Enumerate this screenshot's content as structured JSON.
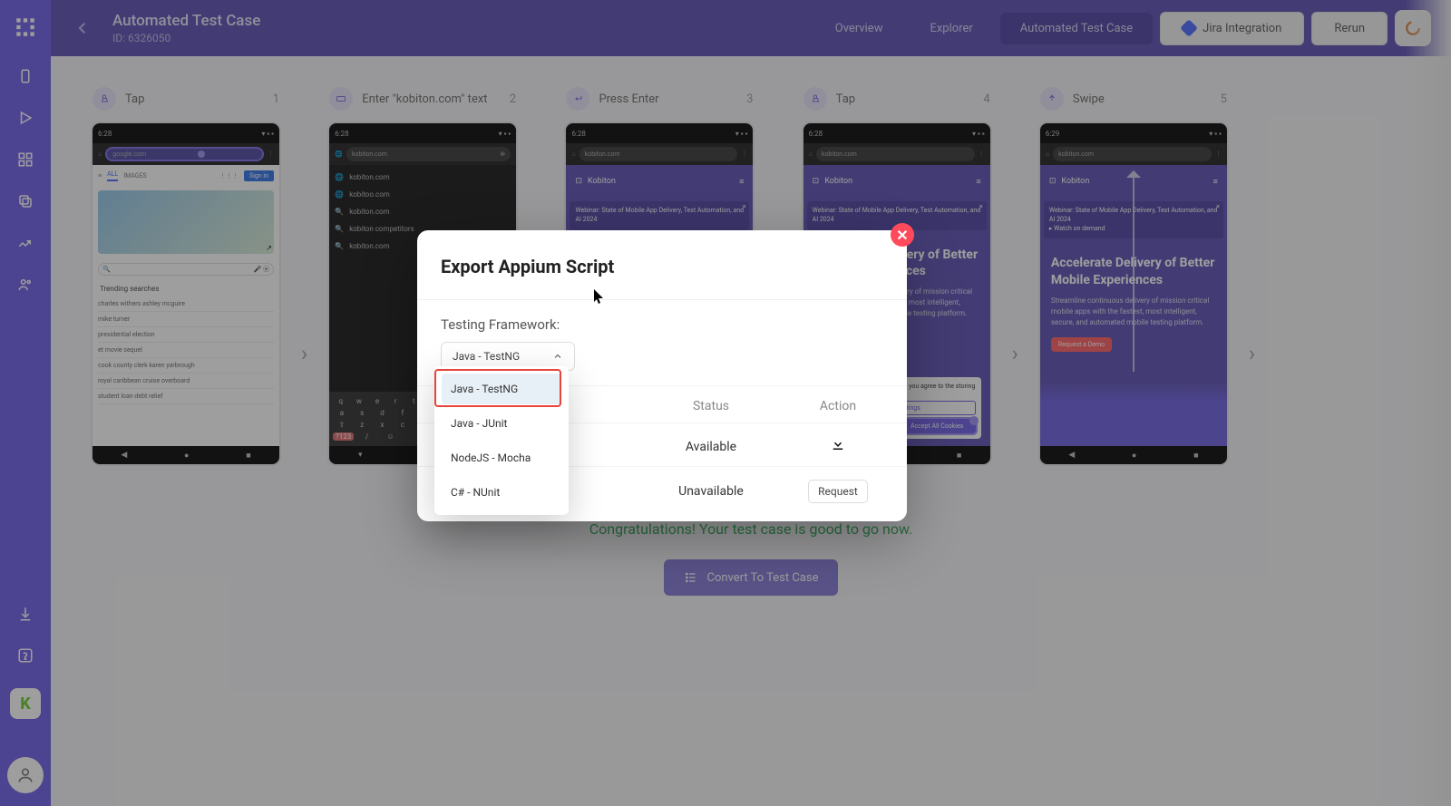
{
  "header": {
    "title": "Automated Test Case",
    "subtitle": "ID: 6326050",
    "tabs": {
      "overview": "Overview",
      "explorer": "Explorer",
      "active": "Automated Test Case"
    },
    "jira_label": "Jira Integration",
    "rerun_label": "Rerun"
  },
  "sidebar": {
    "k_label": "K"
  },
  "steps": [
    {
      "label": "Tap",
      "num": "1"
    },
    {
      "label": "Enter \"kobiton.com\" text",
      "num": "2"
    },
    {
      "label": "Press Enter",
      "num": "3"
    },
    {
      "label": "Tap",
      "num": "4"
    },
    {
      "label": "Swipe",
      "num": "5"
    }
  ],
  "phone": {
    "time1": "6:28",
    "time2": "6:28",
    "time3": "6:28",
    "time4": "6:28",
    "time5": "6:29",
    "url_google": "google.com",
    "url_kob": "kobiton.com",
    "trending_header": "Trending searches",
    "trending": [
      "charles withers ashley mcguire",
      "mike turner",
      "presidential election",
      "et movie sequel",
      "cook county clerk karen yarbrough",
      "royal caribbean cruise overboard",
      "student loan debt relief"
    ],
    "suggestions": [
      "kobiton.com",
      "kobitoo.com",
      "kobiton.com",
      "kobiton competitors",
      "kobiton.com"
    ],
    "kb_title": "Accelerate Delivery of Better Mobile Experiences",
    "kb_sub": "Streamline continuous delivery of mission critical mobile apps with the fastest, most intelligent, secure, and automated mobile testing platform.",
    "kb_cta": "Request a Demo",
    "kb_brand": "Kobiton",
    "kb_banner": "Webinar: State of Mobile App Delivery, Test Automation, and AI 2024"
  },
  "congrats": "Congratulations! Your test case is good to go now.",
  "convert_label": "Convert To Test Case",
  "modal": {
    "title": "Export Appium Script",
    "framework_label": "Testing Framework:",
    "selected": "Java - TestNG",
    "options": [
      "Java - TestNG",
      "Java - JUnit",
      "NodeJS - Mocha",
      "C# - NUnit"
    ],
    "col_status": "Status",
    "col_action": "Action",
    "status_available": "Available",
    "status_unavailable": "Unavailable",
    "request_label": "Request"
  }
}
